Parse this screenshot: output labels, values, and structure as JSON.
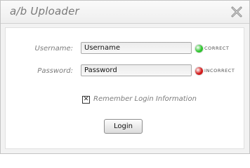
{
  "window": {
    "title": "a/b Uploader",
    "close_icon": "close-x-icon"
  },
  "form": {
    "username": {
      "label": "Username:",
      "value": "Username",
      "status": {
        "text": "CORRECT",
        "color": "#2ec42e",
        "icon": "green-dot-icon"
      }
    },
    "password": {
      "label": "Password:",
      "value": "Password",
      "status": {
        "text": "INCORRECT",
        "color": "#d21a1a",
        "icon": "red-dot-icon"
      }
    },
    "remember": {
      "checked": true,
      "check_glyph": "✕",
      "label": "Remember Login Information"
    },
    "login_label": "Login"
  }
}
